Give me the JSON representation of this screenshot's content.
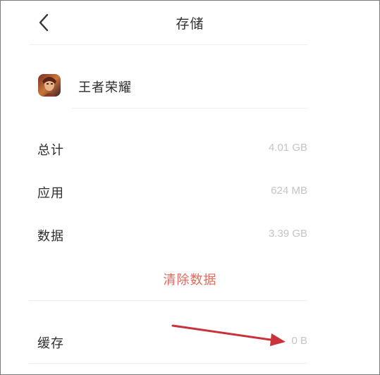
{
  "header": {
    "title": "存储",
    "back_icon": "chevron-left-icon"
  },
  "app": {
    "name": "王者荣耀",
    "icon": "app-icon"
  },
  "storage": {
    "rows": [
      {
        "label": "总计",
        "value": "4.01 GB"
      },
      {
        "label": "应用",
        "value": "624 MB"
      },
      {
        "label": "数据",
        "value": "3.39 GB"
      }
    ],
    "clear_data_label": "清除数据",
    "cache": {
      "label": "缓存",
      "value": "0 B"
    }
  },
  "colors": {
    "accent": "#e26a5c",
    "annotation_arrow": "#c8323a",
    "value_text": "#c4c4c4"
  }
}
